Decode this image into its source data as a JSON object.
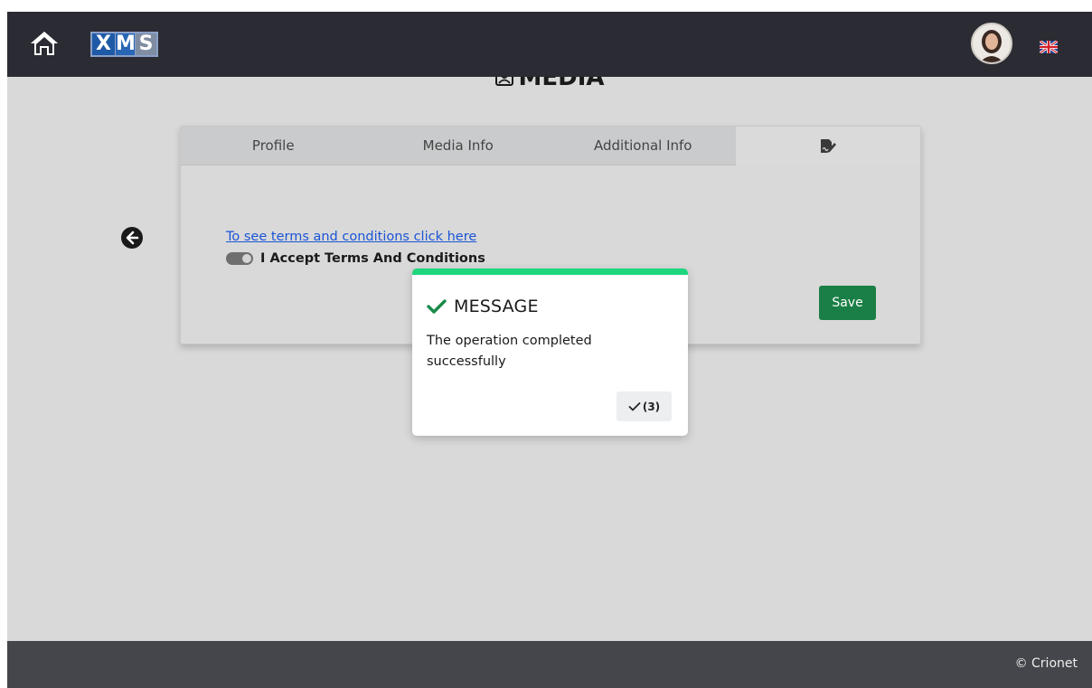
{
  "header": {
    "logo_letters": [
      "X",
      "M",
      "S"
    ],
    "icons": {
      "home": "home-icon",
      "profile": "avatar",
      "language": "uk-flag-icon"
    }
  },
  "page": {
    "title": "MEDIA",
    "title_icon": "user-badge-icon"
  },
  "tabs": [
    {
      "label": "Profile",
      "active": false
    },
    {
      "label": "Media Info",
      "active": false
    },
    {
      "label": "Additional Info",
      "active": false
    },
    {
      "label": "",
      "icon": "signature-icon",
      "active": true
    }
  ],
  "form": {
    "terms_link": "To see terms and conditions click here",
    "accept_label": "I Accept Terms And Conditions",
    "accept_checked": true,
    "save_label": "Save"
  },
  "modal": {
    "title": "MESSAGE",
    "body": "The operation completed successfully",
    "ok_label": "(3)",
    "accent_color": "#1fd67e",
    "check_color": "#1a8a4a"
  },
  "footer": {
    "text": "© Crionet"
  },
  "colors": {
    "topbar": "#2b2c33",
    "background": "#d9d9d9",
    "save_button": "#1a7f46",
    "link": "#1a55d6",
    "footer": "#45464b"
  }
}
